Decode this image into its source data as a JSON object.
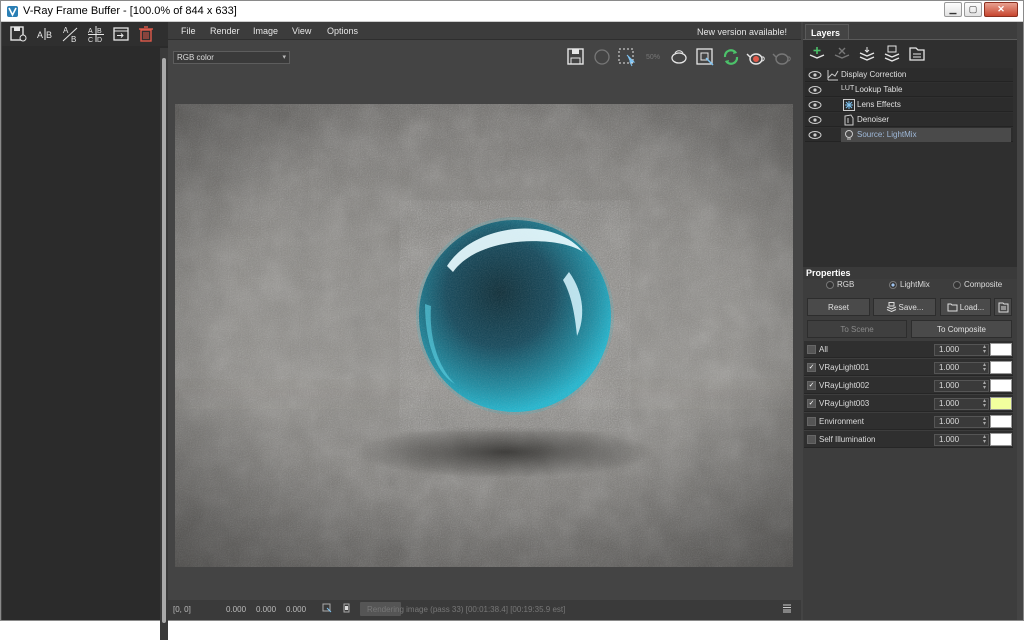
{
  "window": {
    "title": "V-Ray Frame Buffer - [100.0% of 844 x 633]",
    "controls": [
      "minimize-icon",
      "maximize-icon",
      "close-icon"
    ]
  },
  "left_toolbar": {
    "icons": [
      "save-history-icon",
      "ab-horizontal-compare-icon",
      "ab-vertical-compare-icon",
      "abcd-compare-icon",
      "load-to-history-icon",
      "delete-history-icon"
    ]
  },
  "menu": {
    "items": [
      "File",
      "Render",
      "Image",
      "View",
      "Options"
    ],
    "notice": "New version available!"
  },
  "toolbar": {
    "channel_select": "RGB color",
    "icons": [
      "save-image-icon",
      "stop-icon",
      "region-render-icon",
      "percent-icon",
      "render-last-icon",
      "track-mouse-icon",
      "refresh-icon",
      "teapot-render-icon",
      "teapot-interactive-icon"
    ],
    "percent_label": "50%"
  },
  "status": {
    "coords": "[0, 0]",
    "v1": "0.000",
    "v2": "0.000",
    "v3": "0.000",
    "progress_text": "Rendering image (pass 33) [00:01:38.4] [00:19:35.9 est]"
  },
  "layers": {
    "tab_label": "Layers",
    "toolbar_icons": [
      "add-layer-icon",
      "remove-layer-icon",
      "layer-stack-icon",
      "save-layers-icon",
      "load-layers-icon"
    ],
    "items": [
      {
        "label": "Display Correction",
        "icon": "display-correction-icon",
        "selected": false
      },
      {
        "label": "Lookup Table",
        "icon": "lut-icon",
        "prefix": "LUT",
        "selected": false
      },
      {
        "label": "Lens Effects",
        "icon": "lens-effects-icon",
        "selected": false
      },
      {
        "label": "Denoiser",
        "icon": "denoiser-icon",
        "selected": false
      },
      {
        "label": "Source: LightMix",
        "icon": "lightmix-source-icon",
        "selected": true
      }
    ]
  },
  "properties": {
    "header": "Properties",
    "modes": [
      {
        "label": "RGB",
        "selected": false
      },
      {
        "label": "LightMix",
        "selected": true
      },
      {
        "label": "Composite",
        "selected": false
      }
    ],
    "buttons": {
      "reset": "Reset",
      "save": "Save...",
      "load": "Load...",
      "to_scene": "To Scene",
      "to_composite": "To Composite"
    },
    "lights": [
      {
        "name": "All",
        "value": "1.000",
        "checked": false,
        "color": "#ffffff"
      },
      {
        "name": "VRayLight001",
        "value": "1.000",
        "checked": true,
        "color": "#ffffff"
      },
      {
        "name": "VRayLight002",
        "value": "1.000",
        "checked": true,
        "color": "#ffffff"
      },
      {
        "name": "VRayLight003",
        "value": "1.000",
        "checked": true,
        "color": "#f2ff9e"
      },
      {
        "name": "Environment",
        "value": "1.000",
        "checked": false,
        "color": "#ffffff"
      },
      {
        "name": "Self Illumination",
        "value": "1.000",
        "checked": false,
        "color": "#ffffff"
      }
    ]
  },
  "colors": {
    "accent": "#9fb9d9",
    "sphere": "#1aa3b8",
    "red_icon": "#e05a4b",
    "green_icon": "#4cc26a"
  }
}
